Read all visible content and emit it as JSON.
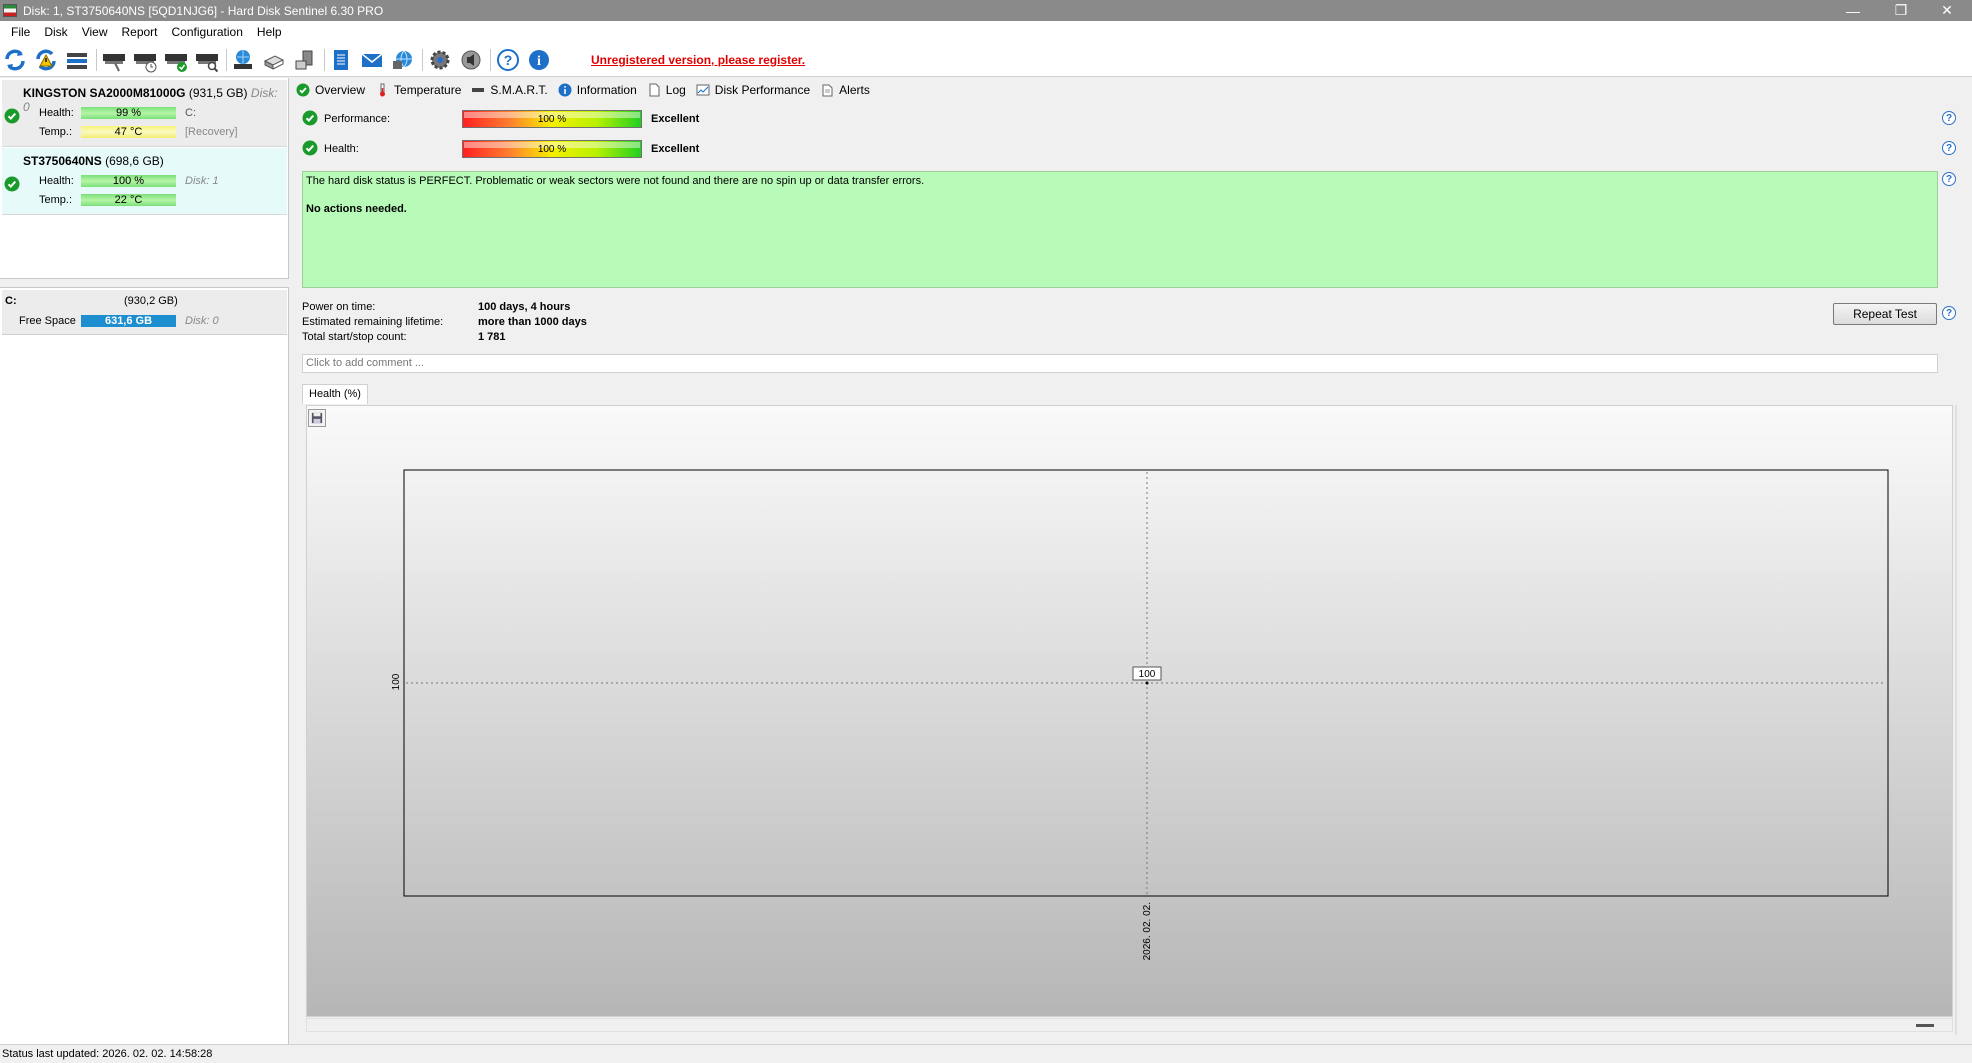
{
  "window": {
    "title": "Disk: 1, ST3750640NS [5QD1NJG6]  -  Hard Disk Sentinel 6.30 PRO",
    "minimize": "—",
    "restore": "❐",
    "close": "✕"
  },
  "menu": [
    {
      "label": "File"
    },
    {
      "label": "Disk"
    },
    {
      "label": "View"
    },
    {
      "label": "Report"
    },
    {
      "label": "Configuration"
    },
    {
      "label": "Help"
    }
  ],
  "toolbar": {
    "icons": [
      "refresh-icon",
      "refresh-warning-icon",
      "disk-list-icon",
      "disk-test-icon",
      "disk-schedule-icon",
      "disk-ok-icon",
      "disk-search-icon",
      "network-drive-icon",
      "remote-drive-icon",
      "usb-drive-icon",
      "report-icon",
      "email-icon",
      "web-icon",
      "settings-icon",
      "sound-icon",
      "help-icon",
      "info-icon"
    ],
    "register_text": "Unregistered version, please register.",
    "colors": {
      "blue": "#1e6fc8",
      "red": "#e00000",
      "gray": "#444444"
    }
  },
  "disks": [
    {
      "name": "KINGSTON SA2000M81000G",
      "size": "(931,5 GB)",
      "disk_label": "Disk: 0",
      "health_label": "Health:",
      "health": "99 %",
      "health_extra": "C:",
      "temp_label": "Temp.:",
      "temp": "47 °C",
      "temp_extra": "[Recovery]"
    },
    {
      "name": "ST3750640NS",
      "size": "(698,6 GB)",
      "health_label": "Health:",
      "health": "100 %",
      "health_extra": "Disk: 1",
      "temp_label": "Temp.:",
      "temp": "22 °C"
    }
  ],
  "volume": {
    "name": "C:",
    "size": "(930,2 GB)",
    "free_label": "Free Space",
    "free": "631,6 GB",
    "disk": "Disk: 0"
  },
  "tabs": [
    {
      "label": "Overview",
      "icon": "check-icon"
    },
    {
      "label": "Temperature",
      "icon": "thermometer-icon"
    },
    {
      "label": "S.M.A.R.T.",
      "icon": "disk-icon"
    },
    {
      "label": "Information",
      "icon": "info-icon"
    },
    {
      "label": "Log",
      "icon": "document-icon"
    },
    {
      "label": "Disk Performance",
      "icon": "chart-icon"
    },
    {
      "label": "Alerts",
      "icon": "alert-icon"
    }
  ],
  "overview": {
    "performance_label": "Performance:",
    "performance_value": "100 %",
    "performance_fraction": 1.0,
    "performance_verdict": "Excellent",
    "health_label": "Health:",
    "health_value": "100 %",
    "health_fraction": 1.0,
    "health_verdict": "Excellent",
    "status_text": "The hard disk status is PERFECT. Problematic or weak sectors were not found and there are no spin up or data transfer errors.",
    "status_action": "No actions needed.",
    "power_on_label": "Power on time:",
    "power_on_value": "100 days, 4 hours",
    "lifetime_label": "Estimated remaining lifetime:",
    "lifetime_value": "more than 1000 days",
    "startstop_label": "Total start/stop count:",
    "startstop_value": "1 781",
    "repeat_test": "Repeat Test",
    "comment_placeholder": "Click to add comment ...",
    "help": "?"
  },
  "graph": {
    "tab_label": "Health (%)"
  },
  "chart_data": {
    "type": "line",
    "x": [
      "2026. 02. 02."
    ],
    "series": [
      {
        "values": [
          100
        ]
      }
    ],
    "ytick": "100",
    "xtick": "2026. 02. 02.",
    "data_label": "100",
    "grid": false
  },
  "status_bar": "Status last updated: 2026. 02. 02. 14:58:28"
}
